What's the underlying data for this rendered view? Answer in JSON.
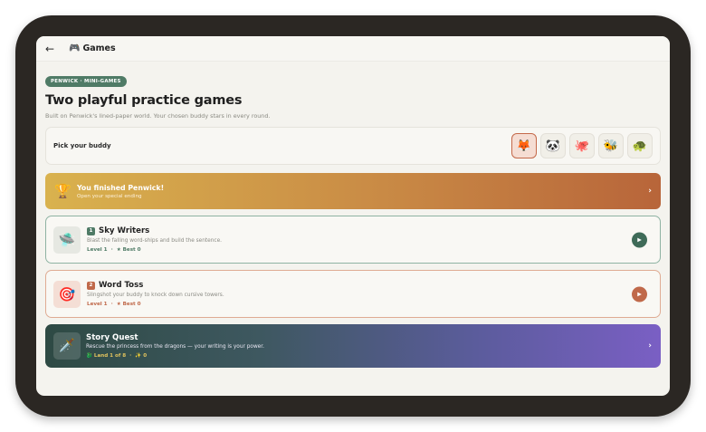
{
  "topbar": {
    "back_icon": "←",
    "title_icon": "🎮",
    "title": "Games"
  },
  "pill": "PENWICK · MINI-GAMES",
  "heading": "Two playful practice games",
  "subheading": "Built on Penwick's lined-paper world. Your chosen buddy stars in every round.",
  "buddy": {
    "label": "Pick your buddy",
    "options": [
      "🦊",
      "🐼",
      "🐙",
      "🐝",
      "🐢"
    ],
    "selected_index": 0
  },
  "banner": {
    "icon": "🏆",
    "title": "You finished Penwick!",
    "subtitle": "Open your special ending",
    "chevron": "›"
  },
  "games": [
    {
      "number": "1",
      "icon": "🛸",
      "title": "Sky Writers",
      "description": "Blast the falling word-ships and build the sentence.",
      "level": "Level 1",
      "dot": "·",
      "best": "★ Best 0",
      "play_icon": "▶"
    },
    {
      "number": "2",
      "icon": "🎯",
      "title": "Word Toss",
      "description": "Slingshot your buddy to knock down cursive towers.",
      "level": "Level 1",
      "dot": "·",
      "best": "★ Best 0",
      "play_icon": "▶"
    }
  ],
  "quest": {
    "icon": "🗡️",
    "title": "Story Quest",
    "description": "Rescue the princess from the dragons — your writing is your power.",
    "land": "🐉 Land 1 of 8",
    "dot": "·",
    "sparkle": "✨ 0",
    "chevron": "›"
  },
  "colors": {
    "accent_green": "#4f7b66",
    "accent_orange": "#c0694a",
    "quest_purple": "#7a5fc4"
  }
}
